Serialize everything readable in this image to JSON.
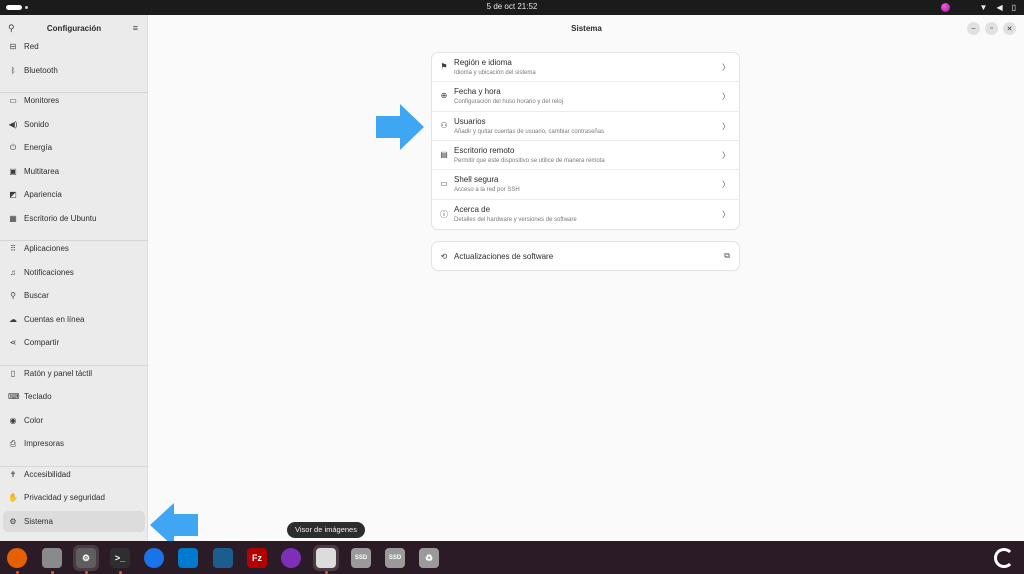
{
  "topbar": {
    "clock": "5 de oct  21:52",
    "tray_icons": [
      "color-picker-icon",
      "wifi-icon",
      "volume-icon",
      "battery-icon"
    ]
  },
  "sidebar": {
    "title": "Configuración",
    "active_item": "Sistema",
    "groups": [
      [
        {
          "label": "Red",
          "icon": "network-icon",
          "glyph": "⊟"
        },
        {
          "label": "Bluetooth",
          "icon": "bluetooth-icon",
          "glyph": "ᛒ"
        }
      ],
      [
        {
          "label": "Monitores",
          "icon": "monitor-icon",
          "glyph": "▭"
        },
        {
          "label": "Sonido",
          "icon": "sound-icon",
          "glyph": "◀)"
        },
        {
          "label": "Energía",
          "icon": "power-icon",
          "glyph": "⏻"
        },
        {
          "label": "Multitarea",
          "icon": "multitask-icon",
          "glyph": "▣"
        },
        {
          "label": "Apariencia",
          "icon": "appearance-icon",
          "glyph": "◩"
        },
        {
          "label": "Escritorio de Ubuntu",
          "icon": "ubuntu-desktop-icon",
          "glyph": "▦"
        }
      ],
      [
        {
          "label": "Aplicaciones",
          "icon": "apps-icon",
          "glyph": "⠿"
        },
        {
          "label": "Notificaciones",
          "icon": "bell-icon",
          "glyph": "♫"
        },
        {
          "label": "Buscar",
          "icon": "search-icon",
          "glyph": "⚲"
        },
        {
          "label": "Cuentas en línea",
          "icon": "cloud-icon",
          "glyph": "☁"
        },
        {
          "label": "Compartir",
          "icon": "share-icon",
          "glyph": "⋖"
        }
      ],
      [
        {
          "label": "Ratón y panel táctil",
          "icon": "mouse-icon",
          "glyph": "▯"
        },
        {
          "label": "Teclado",
          "icon": "keyboard-icon",
          "glyph": "⌨"
        },
        {
          "label": "Color",
          "icon": "color-icon",
          "glyph": "◉"
        },
        {
          "label": "Impresoras",
          "icon": "printer-icon",
          "glyph": "⎙"
        }
      ],
      [
        {
          "label": "Accesibilidad",
          "icon": "accessibility-icon",
          "glyph": "✝"
        },
        {
          "label": "Privacidad y seguridad",
          "icon": "privacy-icon",
          "glyph": "✋"
        },
        {
          "label": "Sistema",
          "icon": "system-icon",
          "glyph": "⚙"
        }
      ]
    ]
  },
  "main": {
    "title": "Sistema",
    "rows": [
      {
        "title": "Región e idioma",
        "subtitle": "Idioma y ubicación del sistema",
        "icon": "flag-icon",
        "glyph": "⚑"
      },
      {
        "title": "Fecha y hora",
        "subtitle": "Configuración del huso horario y del reloj",
        "icon": "clock-icon",
        "glyph": "⊕"
      },
      {
        "title": "Usuarios",
        "subtitle": "Añadir y quitar cuentas de usuario, cambiar contraseñas",
        "icon": "users-icon",
        "glyph": "⚇"
      },
      {
        "title": "Escritorio remoto",
        "subtitle": "Permitir que este dispositivo se utilice de manera remota",
        "icon": "remote-desktop-icon",
        "glyph": "▤"
      },
      {
        "title": "Shell segura",
        "subtitle": "Acceso a la red por SSH",
        "icon": "terminal-icon",
        "glyph": "▭"
      },
      {
        "title": "Acerca de",
        "subtitle": "Detalles del hardware y versiones de software",
        "icon": "info-icon",
        "glyph": "ⓘ"
      }
    ],
    "updates": {
      "title": "Actualizaciones de software",
      "icon": "update-icon",
      "glyph": "⟲",
      "action_icon": "external-link-icon"
    }
  },
  "tooltip": "Visor de imágenes",
  "dock": {
    "apps": [
      {
        "name": "firefox",
        "color": "#e66000",
        "label": "",
        "running": true
      },
      {
        "name": "files",
        "color": "#8a8a8a",
        "label": "",
        "running": true
      },
      {
        "name": "settings",
        "color": "#5e5e5e",
        "label": "⚙",
        "running": true
      },
      {
        "name": "terminal",
        "color": "#2e2e2e",
        "label": ">_",
        "running": true
      },
      {
        "name": "chrome",
        "color": "#1a73e8",
        "label": "",
        "running": false
      },
      {
        "name": "vscode",
        "color": "#007acc",
        "label": "",
        "running": false
      },
      {
        "name": "virtualbox",
        "color": "#1c5d8f",
        "label": "",
        "running": false
      },
      {
        "name": "filezilla",
        "color": "#b30000",
        "label": "Fz",
        "running": false
      },
      {
        "name": "tor-browser",
        "color": "#7e2fb8",
        "label": "",
        "running": false
      },
      {
        "name": "image-viewer",
        "color": "#dcdcdc",
        "label": "",
        "running": true
      },
      {
        "name": "ssd-drive-1",
        "color": "#9a9a9a",
        "label": "SSD",
        "running": false
      },
      {
        "name": "ssd-drive-2",
        "color": "#9a9a9a",
        "label": "SSD",
        "running": false
      },
      {
        "name": "trash",
        "color": "#9a9a9a",
        "label": "♻",
        "running": false
      }
    ]
  },
  "colors": {
    "accent_arrow": "#3ea6f2",
    "dock_bg": "#2b1b26",
    "ubuntu_orange": "#e95420"
  }
}
